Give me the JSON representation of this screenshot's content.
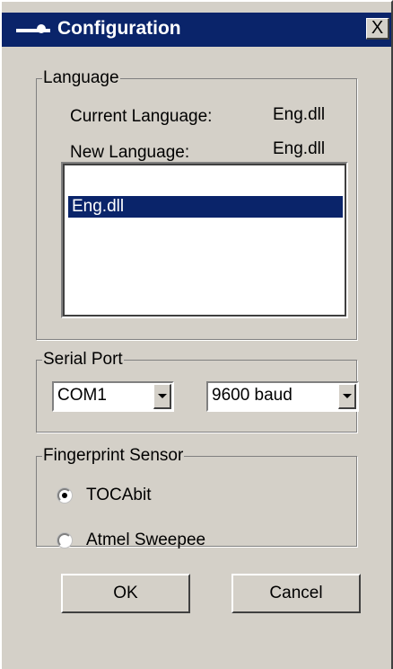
{
  "window": {
    "title": "Configuration",
    "close_label": "X"
  },
  "language": {
    "group_label": "Language",
    "current_label": "Current Language:",
    "current_value": "Eng.dll",
    "new_label": "New Language:",
    "new_value": "Eng.dll",
    "list_items": [
      "Eng.dll"
    ],
    "selected_item": "Eng.dll"
  },
  "serial_port": {
    "group_label": "Serial Port",
    "port_value": "COM1",
    "baud_value": "9600 baud"
  },
  "fingerprint_sensor": {
    "group_label": "Fingerprint Sensor",
    "options": [
      {
        "label": "TOCAbit",
        "checked": true
      },
      {
        "label": "Atmel Sweepee",
        "checked": false
      }
    ]
  },
  "buttons": {
    "ok_label": "OK",
    "cancel_label": "Cancel"
  },
  "colors": {
    "titlebar": "#0a246a",
    "face": "#d4d0c8",
    "selection": "#0a246a"
  }
}
